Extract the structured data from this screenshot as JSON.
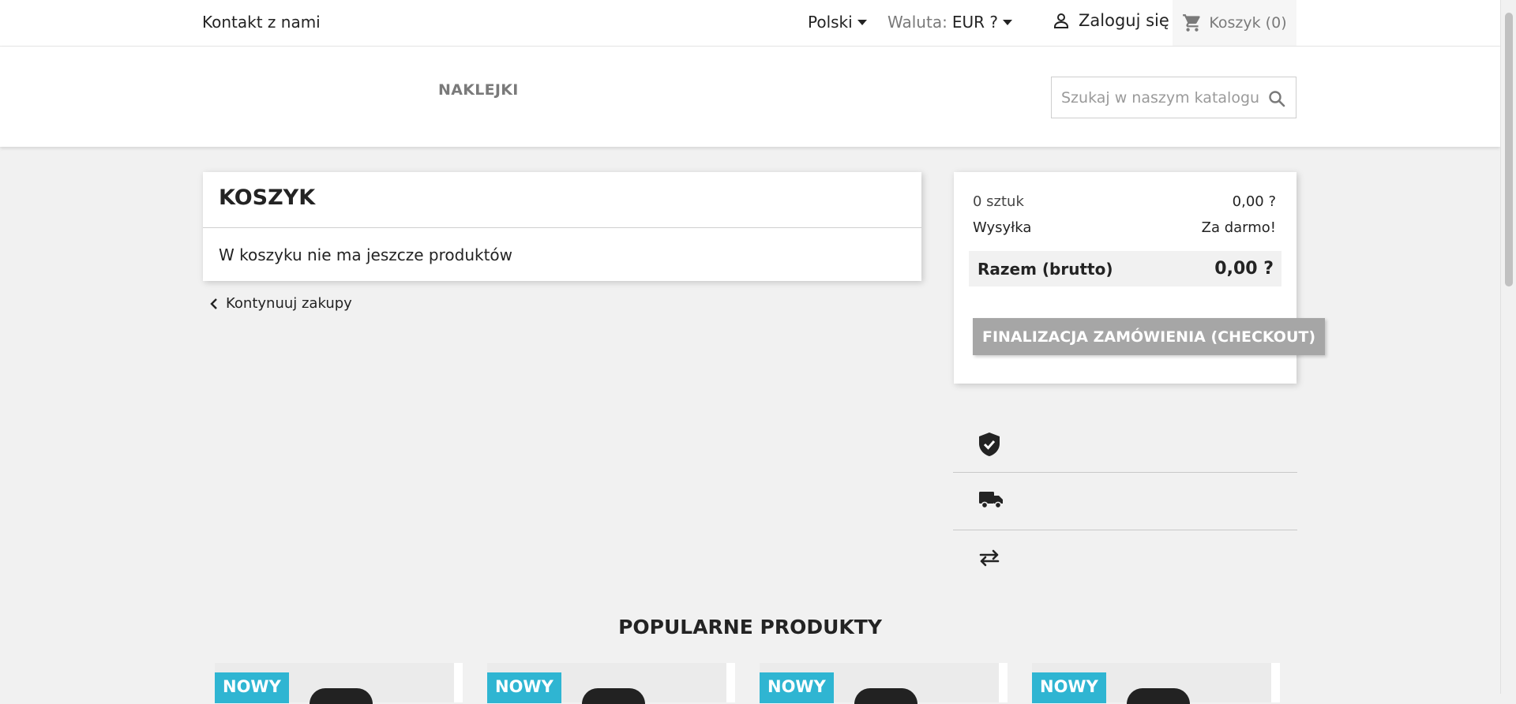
{
  "topnav": {
    "contact": "Kontakt z nami",
    "language": "Polski",
    "currency_label": "Waluta:",
    "currency_value": "EUR ?",
    "login": "Zaloguj się",
    "cart": "Koszyk (0)"
  },
  "header": {
    "menu": [
      "NAKLEJKI"
    ],
    "search_placeholder": "Szukaj w naszym katalogu"
  },
  "cart": {
    "title": "KOSZYK",
    "empty_message": "W koszyku nie ma jeszcze produktów",
    "continue_label": "Kontynuuj zakupy"
  },
  "summary": {
    "items_label": "0 sztuk",
    "items_value": "0,00 ?",
    "shipping_label": "Wysyłka",
    "shipping_value": "Za darmo!",
    "total_label": "Razem (brutto)",
    "total_value": "0,00 ?",
    "checkout_label": "FINALIZACJA ZAMÓWIENIA (CHECKOUT)"
  },
  "reassurance": [
    "shield-check-icon",
    "truck-icon",
    "swap-arrows-icon"
  ],
  "popular": {
    "title": "POPULARNE PRODUKTY",
    "products": [
      {
        "badge": "NOWY"
      },
      {
        "badge": "NOWY"
      },
      {
        "badge": "NOWY"
      },
      {
        "badge": "NOWY"
      }
    ]
  },
  "colors": {
    "accent": "#2fb5d2",
    "checkout_button": "#a6a6a6",
    "page_background": "#f1f1f1"
  }
}
